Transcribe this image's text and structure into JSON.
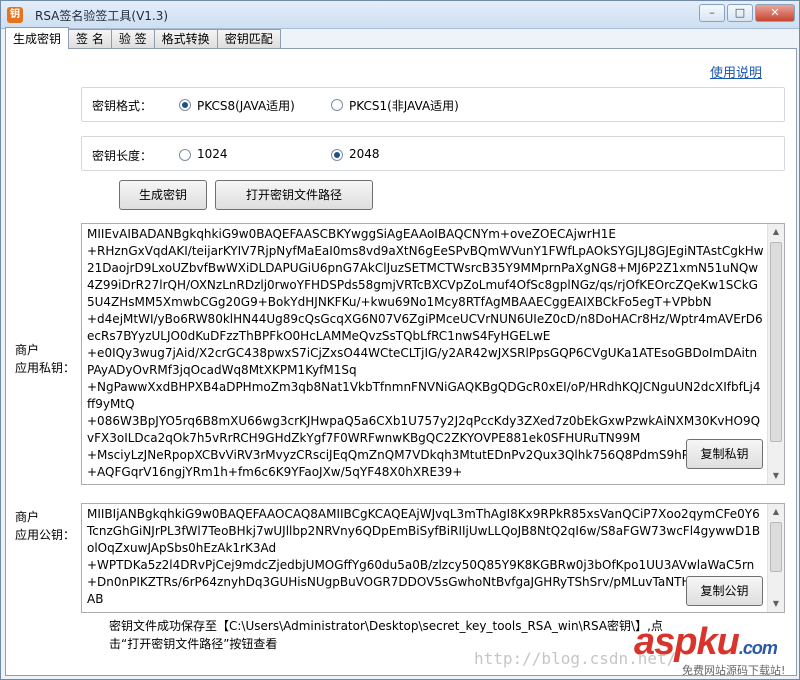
{
  "window": {
    "title": "RSA签名验签工具(V1.3)",
    "icon_text": "钥",
    "controls": [
      "minimize-icon",
      "maximize-icon",
      "close-icon"
    ]
  },
  "tabs": [
    {
      "label": "生成密钥",
      "active": true
    },
    {
      "label": "签 名",
      "active": false
    },
    {
      "label": "验 签",
      "active": false
    },
    {
      "label": "格式转换",
      "active": false
    },
    {
      "label": "密钥匹配",
      "active": false
    }
  ],
  "help_link": "使用说明",
  "key_format": {
    "label": "密钥格式：",
    "options": [
      {
        "label": "PKCS8(JAVA适用)",
        "checked": true
      },
      {
        "label": "PKCS1(非JAVA适用)",
        "checked": false
      }
    ]
  },
  "key_length": {
    "label": "密钥长度：",
    "options": [
      {
        "label": "1024",
        "checked": false
      },
      {
        "label": "2048",
        "checked": true
      }
    ]
  },
  "buttons": {
    "generate": "生成密钥",
    "open_path": "打开密钥文件路径",
    "copy_private": "复制私钥",
    "copy_public": "复制公钥"
  },
  "private_key": {
    "label_line1": "商户",
    "label_line2": "应用私钥：",
    "text": "MIIEvAIBADANBgkqhkiG9w0BAQEFAASCBKYwggSiAgEAAoIBAQCNYm+oveZOECAjwrH1E\n+RHznGxVqdAKI/teijarKYIV7RjpNyfMaEaI0ms8vd9aXtN6gEeSPvBQmWVunY1FWfLpAOkSYGJLJ8GJEgiNTAstCgkHw21DaojrD9LxoUZbvfBwWXiDLDAPUGiU6pnG7AkClJuzSETMCTWsrcB35Y9MMprnPaXgNG8+MJ6P2Z1xmN51uNQw4Z99iDrR27lrQH/OXNzLnRDzlj0rwoYFHDSPds58gmjVRTcBXCVpZoLmuf4OfSc8gplNGz/qs/rjOfKEOrcZQeKw1SCkG5U4ZHsMM5XmwbCGg20G9+BokYdHJNKFKu/+kwu69No1Mcy8RTfAgMBAAECggEAIXBCkFo5egT+VPbbN\n+d4ejMtWI/yBo6RW80klHN44Ug89cQsGcqXG6N07V6ZgiPMceUCVrNUN6UIeZ0cD/n8DoHACr8Hz/Wptr4mAVErD6ecRs7BYyzULJO0dKuDFzzThBPFkO0HcLAMMeQvzSsTQbLfRC1nwS4FyHGELwE\n+e0IQy3wug7jAid/X2crGC438pwxS7iCjZxsO44WCteCLTjIG/y2AR42wJXSRlPpsGQP6CVgUKa1ATEsoGBDoImDAitnPAyADyOvRMf3jqOcadWq8MtXKPM1KyfM1Sq\n+NgPawwXxdBHPXB4aDPHmoZm3qb8Nat1VkbTfnmnFNVNiGAQKBgQDGcR0xEI/oP/HRdhKQJCNguUN2dcXIfbfLj4ff9yMtQ\n+086W3BpJYO5rq6B8mXU66wg3crKJHwpaQ5a6CXb1U757y2J2qPccKdy3ZXed7z0bEkGxwPzwkAiNXM30KvHO9QvFX3oILDca2qOk7h5vRrRCH9GHdZkYgf7F0WRFwnwKBgQC2ZKYOVPE881ek0SFHURuTN99M\n+MsciyLzJNeRpopXCBvViRV3rMvyzCRsciJEqQmZnQM7VDkqh3MtutEDnPv2Qux3Qlhk756Q8PdmS9hPl9\n+AQFGqrV16ngjYRm1h+fm6c6K9YFaoJXw/5qYF48X0hXRE39+"
  },
  "public_key": {
    "label_line1": "商户",
    "label_line2": "应用公钥：",
    "text": "MIIBIjANBgkqhkiG9w0BAQEFAAOCAQ8AMIIBCgKCAQEAjWJvqL3mThAgI8Kx9RPkR85xsVanQCiP7Xoo2qymCFe0Y6TcnzGhGiNJrPL3fWl7TeoBHkj7wUJllbp2NRVny6QDpEmBiSyfBiRIIjUwLLQoJB8NtQ2qI6w/S8aFGW73wcFl4gywwD1BolOqZxuwJApSbs0hEzAk1rK3Ad\n+WPTDKa5z2l4DRvPjCej9mdcZjedbjUMOGffYg60du5a0B/zlzcy50Q85Y9K8KGBRw0j3bOfKpo1UU3AVwlaWaC5rn\n+Dn0nPIKZTRs/6rP64znyhDq3GUHisNUgpBuVOGR7DDOV5sGwhoNtBvfgaJGHRyTShSrv/pMLuvTaNTHM\nAB"
  },
  "status": {
    "line1": "密钥文件成功保存至【C:\\Users\\Administrator\\Desktop\\secret_key_tools_RSA_win\\RSA密钥\\】,点",
    "line2": "击“打开密钥文件路径”按钮查看"
  },
  "watermark": {
    "url": "http://blog.csdn.net/",
    "logo": "aspku",
    "logo_suffix": ".com",
    "sub": "免费网站源码下载站!"
  }
}
